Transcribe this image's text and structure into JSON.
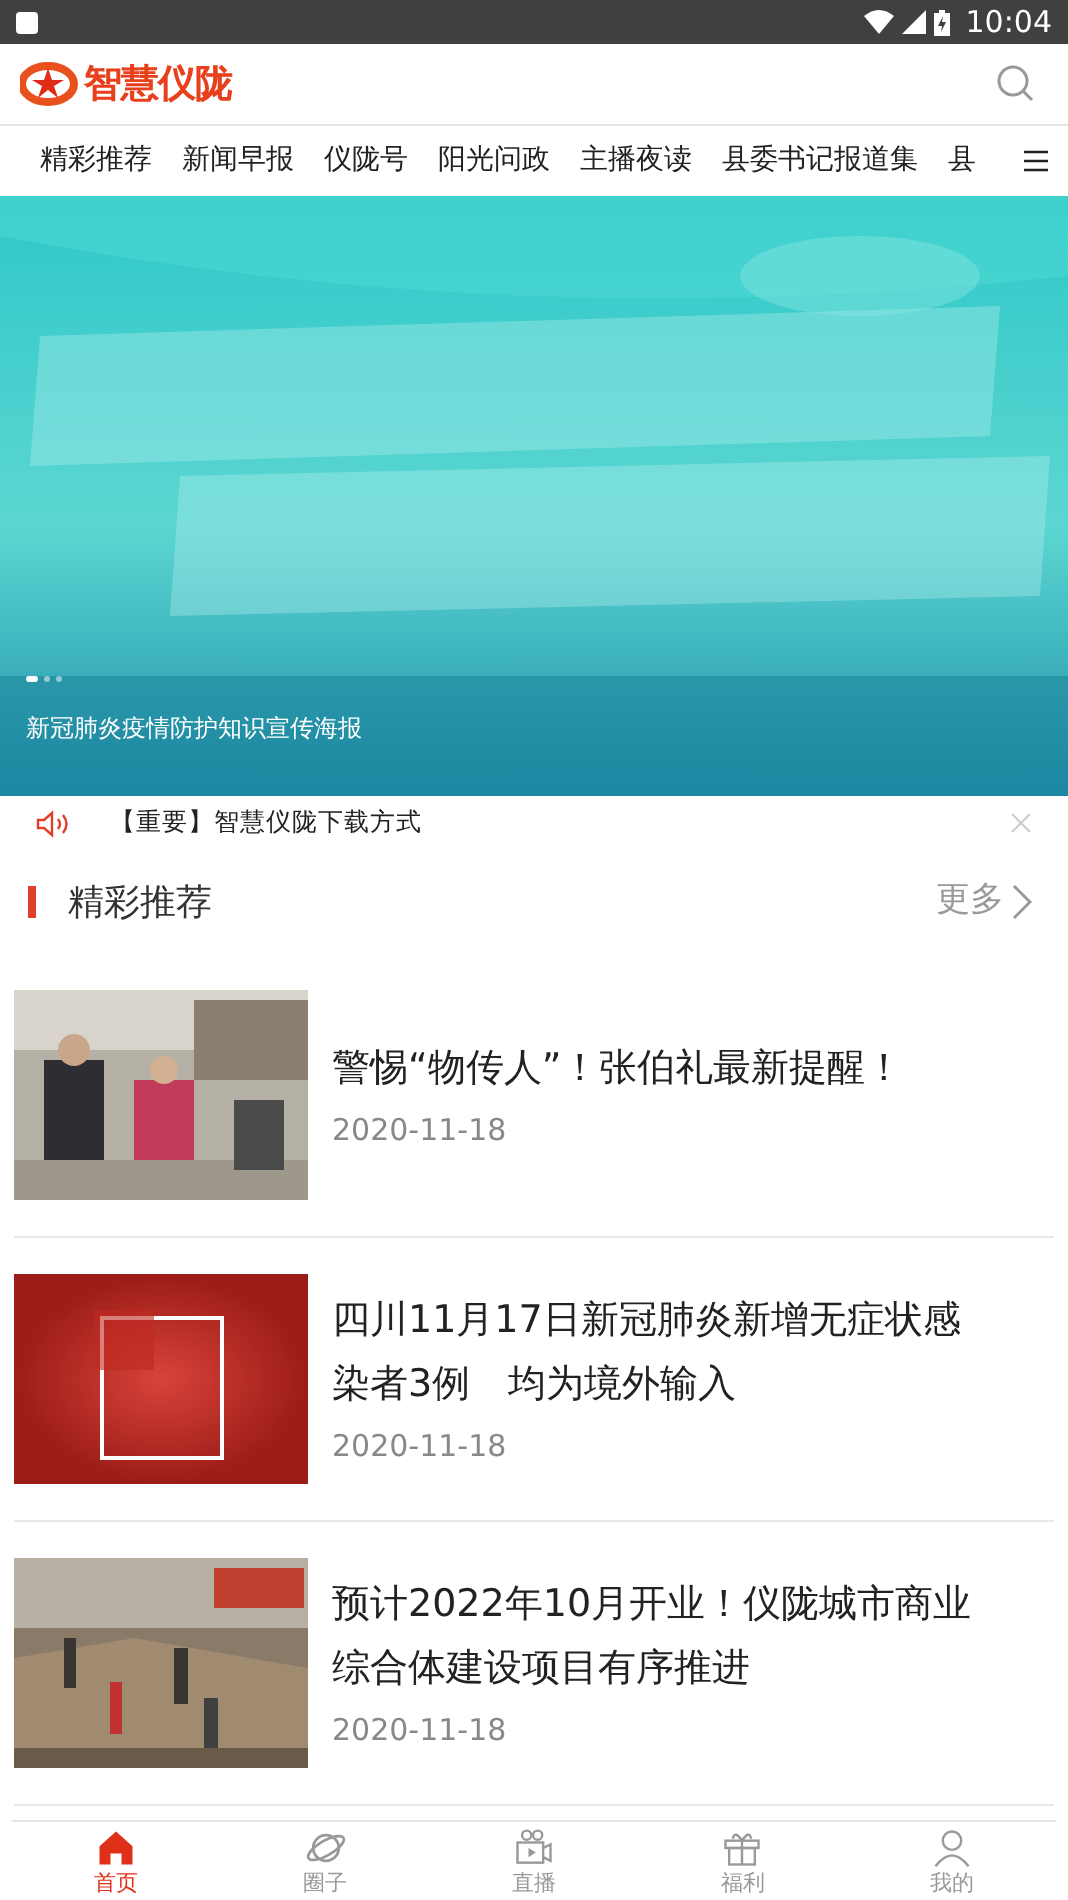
{
  "status_bar": {
    "time": "10:04"
  },
  "header": {
    "logo_text": "智慧仪陇"
  },
  "channels": [
    {
      "label": "精彩推荐",
      "selected": false
    },
    {
      "label": "新闻早报",
      "selected": false
    },
    {
      "label": "仪陇号",
      "selected": false
    },
    {
      "label": "阳光问政",
      "selected": false
    },
    {
      "label": "主播夜读",
      "selected": false
    },
    {
      "label": "县委书记报道集",
      "selected": false
    },
    {
      "label": "县",
      "selected": false
    }
  ],
  "banner": {
    "caption": "新冠肺炎疫情防护知识宣传海报",
    "dots": [
      {
        "selected": true
      },
      {
        "selected": false
      },
      {
        "selected": false
      }
    ]
  },
  "notice": {
    "text": "【重要】智慧仪陇下载方式"
  },
  "section": {
    "title": "精彩推荐",
    "more": "更多"
  },
  "articles": [
    {
      "title": "警惕“物传人”！张伯礼最新提醒！",
      "date": "2020-11-18"
    },
    {
      "title": "四川11月17日新冠肺炎新增无症状感染者3例　均为境外输入",
      "date": "2020-11-18"
    },
    {
      "title": "预计2022年10月开业！仪陇城市商业综合体建设项目有序推进",
      "date": "2020-11-18"
    }
  ],
  "bottom_nav": [
    {
      "label": "首页",
      "selected": true
    },
    {
      "label": "圈子",
      "selected": false
    },
    {
      "label": "直播",
      "selected": false
    },
    {
      "label": "福利",
      "selected": false
    },
    {
      "label": "我的",
      "selected": false
    }
  ]
}
